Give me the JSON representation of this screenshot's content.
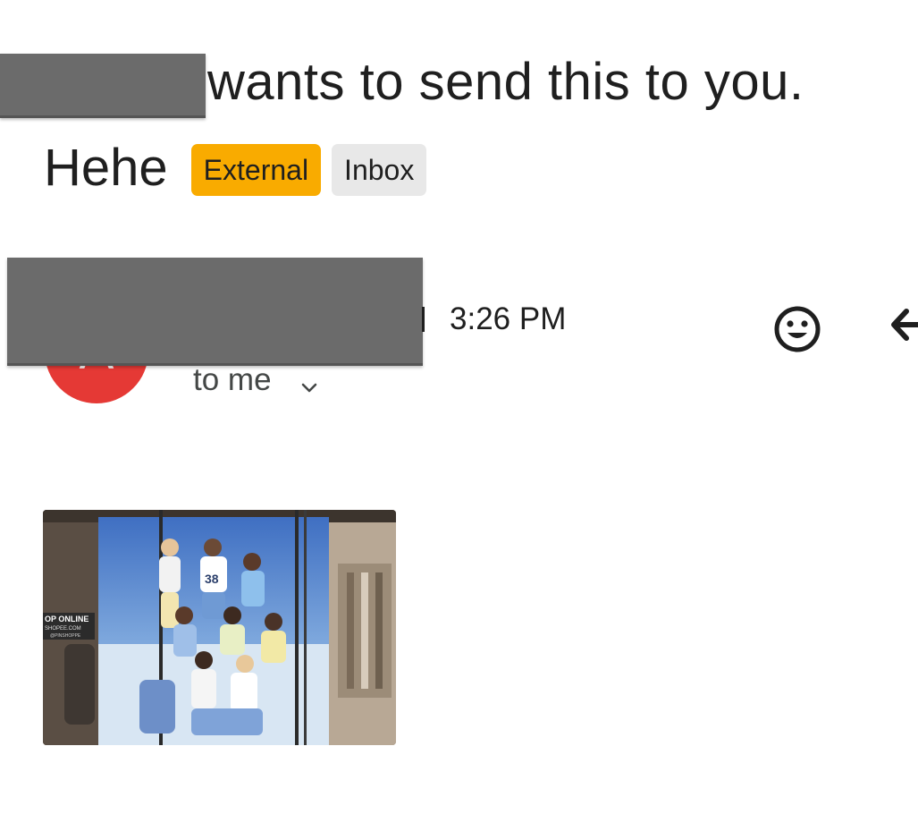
{
  "banner": {
    "text": "wants to send this to you."
  },
  "message": {
    "subject": "Hehe",
    "labels": {
      "external": "External",
      "inbox": "Inbox"
    },
    "sender_initial": "A",
    "time": "3:26 PM",
    "recipient": "to me"
  },
  "attachment": {
    "sign_line1": "OP ONLINE",
    "sign_line2": "SHOPEE.COM",
    "sign_line3": "@PINSHOPPE",
    "shirt_number": "38"
  },
  "colors": {
    "external_label": "#f9ab00",
    "inbox_label": "#e8e8e8",
    "avatar": "#e53935",
    "redaction": "#6b6b6b"
  },
  "icons": {
    "emoji": "smiley-face-icon",
    "reply": "reply-arrow-icon",
    "chevron": "chevron-down-icon"
  }
}
